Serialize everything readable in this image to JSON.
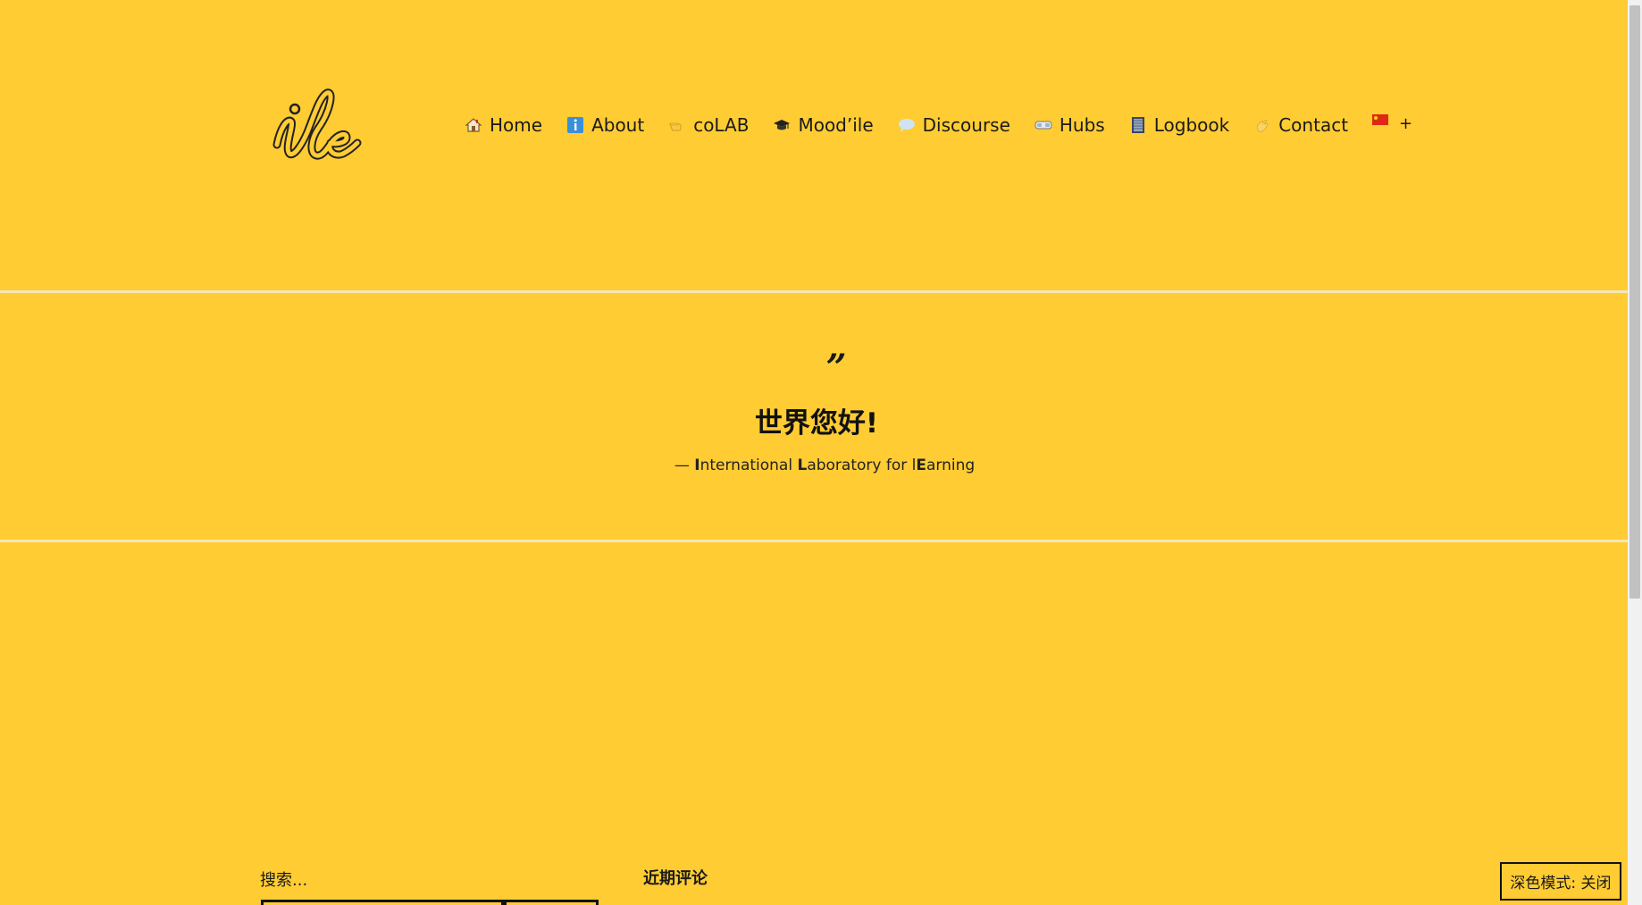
{
  "header": {
    "logo_text": "ile",
    "nav": [
      {
        "label": "Home",
        "icon": "house-icon"
      },
      {
        "label": "About",
        "icon": "info-icon"
      },
      {
        "label": "coLAB",
        "icon": "pointing-hand-icon"
      },
      {
        "label": "Mood’ile",
        "icon": "graduation-cap-icon"
      },
      {
        "label": "Discourse",
        "icon": "speech-bubble-icon"
      },
      {
        "label": "Hubs",
        "icon": "vr-goggles-icon"
      },
      {
        "label": "Logbook",
        "icon": "notebook-icon"
      },
      {
        "label": "Contact",
        "icon": "waving-hand-icon"
      }
    ],
    "language_flag": "china-flag-icon",
    "plus_label": "+"
  },
  "quote": {
    "mark": "”",
    "text": "世界您好!",
    "attribution_prefix": "— ",
    "attribution_parts": [
      "I",
      "nternational ",
      "L",
      "aboratory for l",
      "E",
      "arning"
    ]
  },
  "footer": {
    "search_label": "搜索...",
    "recent_comments_title": "近期评论",
    "dark_mode_label": "深色模式:  关闭"
  },
  "colors": {
    "background": "#FFCC33",
    "text": "#1a1a1a",
    "info_icon": "#3b8fd9"
  }
}
